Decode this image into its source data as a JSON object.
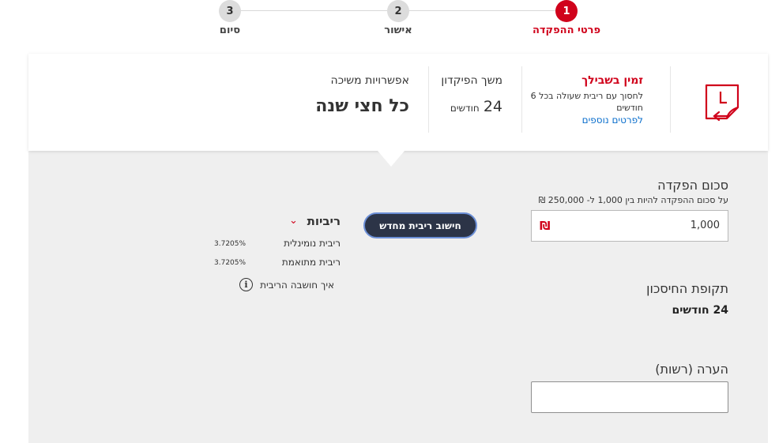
{
  "stepper": {
    "steps": [
      {
        "number": "1",
        "label": "פרטי ההפקדה",
        "active": true
      },
      {
        "number": "2",
        "label": "אישור",
        "active": false
      },
      {
        "number": "3",
        "label": "סיום",
        "active": false
      }
    ]
  },
  "summary": {
    "promo_title": "זמין בשבילך",
    "promo_subtitle": "לחסוך עם ריבית שעולה בכל 6 חודשים",
    "promo_link": "לפרטים נוספים",
    "term_label": "משך הפיקדון",
    "term_number": "24",
    "term_unit": "חודשים",
    "withdraw_label": "אפשרויות משיכה",
    "withdraw_value": "כל חצי שנה",
    "icon": "calendar-clock-icon"
  },
  "form": {
    "deposit_title": "סכום הפקדה",
    "deposit_hint": "על סכום ההפקדה להיות בין 1,000 ל- 250,000 ₪",
    "amount_value": "1,000",
    "currency_symbol": "₪",
    "period_title": "תקופת החיסכון",
    "period_value": "24 חודשים",
    "note_title": "הערה (רשות)",
    "note_value": ""
  },
  "recalc_button": "חישוב ריבית מחדש",
  "rates": {
    "title": "ריביות",
    "nominal_label": "ריבית נומינלית",
    "nominal_value": "3.7205%",
    "adjusted_label": "ריבית מתואמת",
    "adjusted_value": "3.7205%",
    "info_text": "איך חושבה הריבית",
    "info_icon": "i"
  },
  "colors": {
    "accent": "#d0021b",
    "button_bg": "#2c3447",
    "panel_bg": "#efefef",
    "link": "#0a6ecc"
  }
}
